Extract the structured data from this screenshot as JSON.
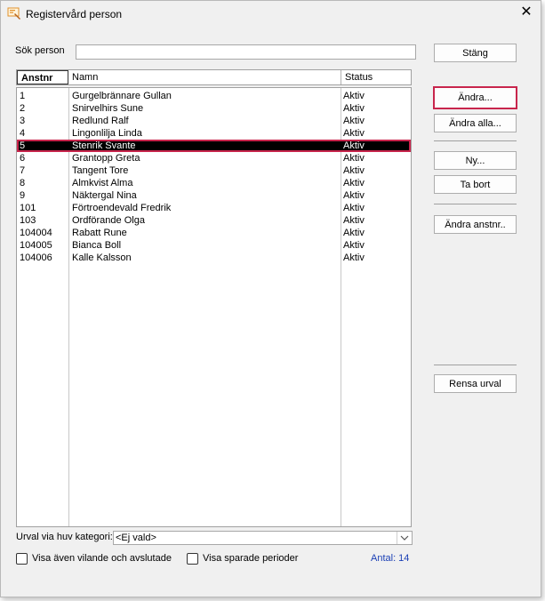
{
  "window": {
    "title": "Registervård person"
  },
  "search": {
    "label": "Sök person",
    "value": ""
  },
  "columns": [
    "Anstnr",
    "Namn",
    "Status"
  ],
  "rows": [
    {
      "id": "1",
      "name": "Gurgelbrännare Gullan",
      "status": "Aktiv"
    },
    {
      "id": "2",
      "name": "Snirvelhirs Sune",
      "status": "Aktiv"
    },
    {
      "id": "3",
      "name": "Redlund Ralf",
      "status": "Aktiv"
    },
    {
      "id": "4",
      "name": "Lingonlilja Linda",
      "status": "Aktiv"
    },
    {
      "id": "5",
      "name": "Stenrik Svante",
      "status": "Aktiv"
    },
    {
      "id": "6",
      "name": "Grantopp Greta",
      "status": "Aktiv"
    },
    {
      "id": "7",
      "name": "Tangent Tore",
      "status": "Aktiv"
    },
    {
      "id": "8",
      "name": "Almkvist Alma",
      "status": "Aktiv"
    },
    {
      "id": "9",
      "name": "Näktergal Nina",
      "status": "Aktiv"
    },
    {
      "id": "101",
      "name": "Förtroendevald Fredrik",
      "status": "Aktiv"
    },
    {
      "id": "103",
      "name": "Ordförande Olga",
      "status": "Aktiv"
    },
    {
      "id": "104004",
      "name": "Rabatt Rune",
      "status": "Aktiv"
    },
    {
      "id": "104005",
      "name": "Bianca Boll",
      "status": "Aktiv"
    },
    {
      "id": "104006",
      "name": "Kalle Kalsson",
      "status": "Aktiv"
    }
  ],
  "selected_row": 4,
  "buttons": {
    "close": "Stäng",
    "edit": "Ändra...",
    "edit_all": "Ändra alla...",
    "new": "Ny...",
    "delete": "Ta bort",
    "edit_empno": "Ändra anstnr..",
    "clear_selection": "Rensa urval"
  },
  "filter": {
    "label": "Urval via huv kategori:",
    "value": "<Ej vald>"
  },
  "options": {
    "show_inactive": "Visa även vilande och avslutade",
    "show_saved_periods": "Visa sparade perioder"
  },
  "count_text": "Antal: 14",
  "colors": {
    "accent": "#c8254c",
    "selection": "#000000",
    "count": "#1a3fb5"
  }
}
